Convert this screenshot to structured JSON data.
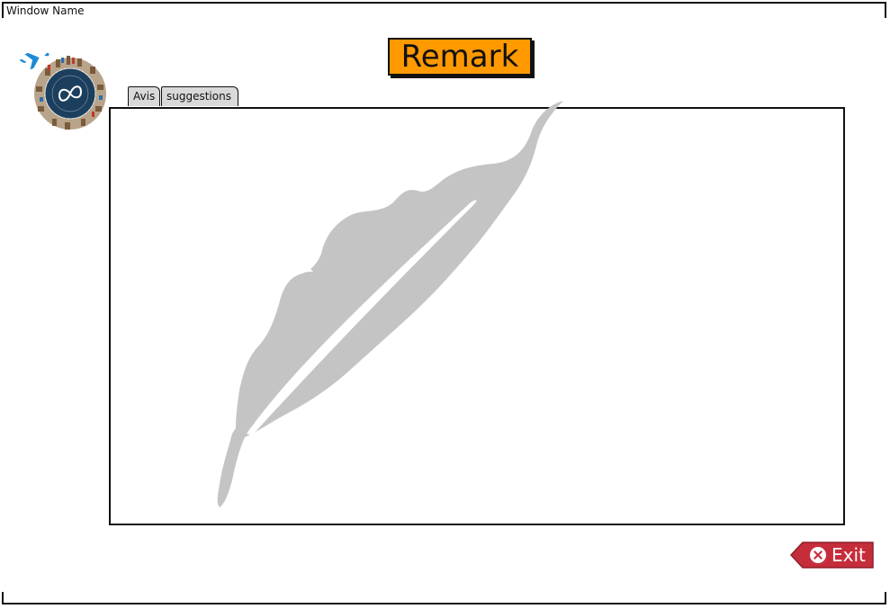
{
  "window": {
    "title": "Window Name"
  },
  "header": {
    "title": "Remark"
  },
  "tabs": [
    {
      "label": "Avis"
    },
    {
      "label": "suggestions"
    }
  ],
  "buttons": {
    "exit_label": "Exit"
  },
  "icons": {
    "logo": "travel-globe-logo",
    "background": "feather-icon",
    "exit": "close-circle-icon"
  },
  "colors": {
    "title_bg": "#ff9900",
    "exit_bg": "#c62d3a",
    "tab_bg": "#d9d9d9",
    "feather": "#c4c4c4"
  }
}
